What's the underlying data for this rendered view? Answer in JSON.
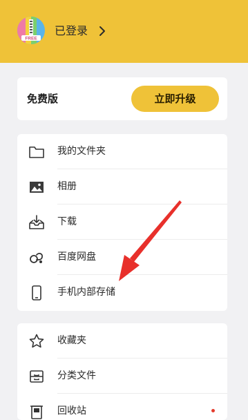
{
  "header": {
    "status_text": "已登录",
    "chevron_icon": "chevron-right-icon",
    "avatar_badge": "FREE",
    "bg_color": "#efc238"
  },
  "vip_card": {
    "plan_label": "免费版",
    "upgrade_label": "立即升级"
  },
  "files_menu": {
    "items": [
      {
        "label": "我的文件夹",
        "icon": "folder-icon"
      },
      {
        "label": "相册",
        "icon": "photo-icon"
      },
      {
        "label": "下载",
        "icon": "download-icon"
      },
      {
        "label": "百度网盘",
        "icon": "cloud-drive-icon"
      },
      {
        "label": "手机内部存储",
        "icon": "phone-icon"
      }
    ]
  },
  "more_menu": {
    "items": [
      {
        "label": "收藏夹",
        "icon": "star-icon"
      },
      {
        "label": "分类文件",
        "icon": "category-box-icon"
      },
      {
        "label": "回收站",
        "icon": "trash-icon",
        "has_dot": true
      }
    ]
  },
  "annotation": {
    "arrow_color": "#e8302b"
  }
}
